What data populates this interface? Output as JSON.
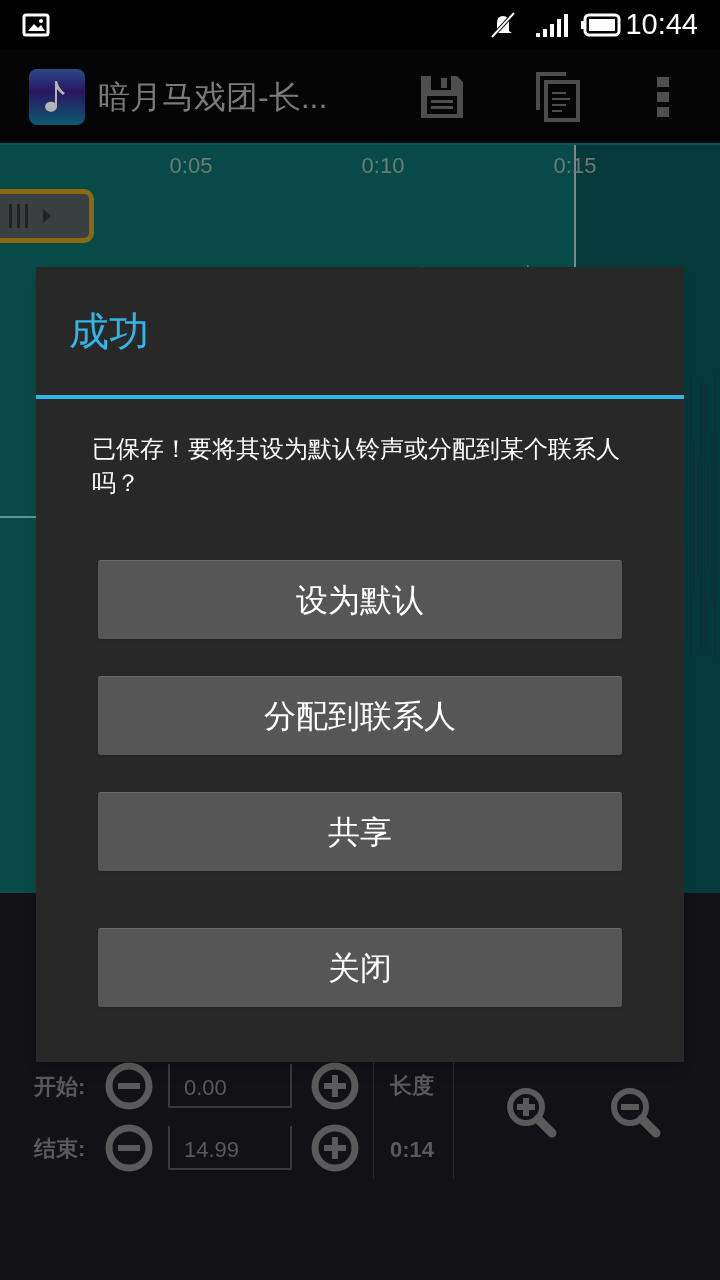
{
  "status_bar": {
    "time": "10:44"
  },
  "action_bar": {
    "title": "暗月马戏团-长..."
  },
  "waveform": {
    "timeline": [
      "0:05",
      "0:10",
      "0:15"
    ]
  },
  "dialog": {
    "title": "成功",
    "message": "已保存！要将其设为默认铃声或分配到某个联系人吗？",
    "buttons": [
      "设为默认",
      "分配到联系人",
      "共享"
    ],
    "close_button": "关闭"
  },
  "controls": {
    "start_label": "开始:",
    "start_value": "0.00",
    "end_label": "结束:",
    "end_value": "14.99",
    "length_label": "长度",
    "length_value": "0:14"
  }
}
